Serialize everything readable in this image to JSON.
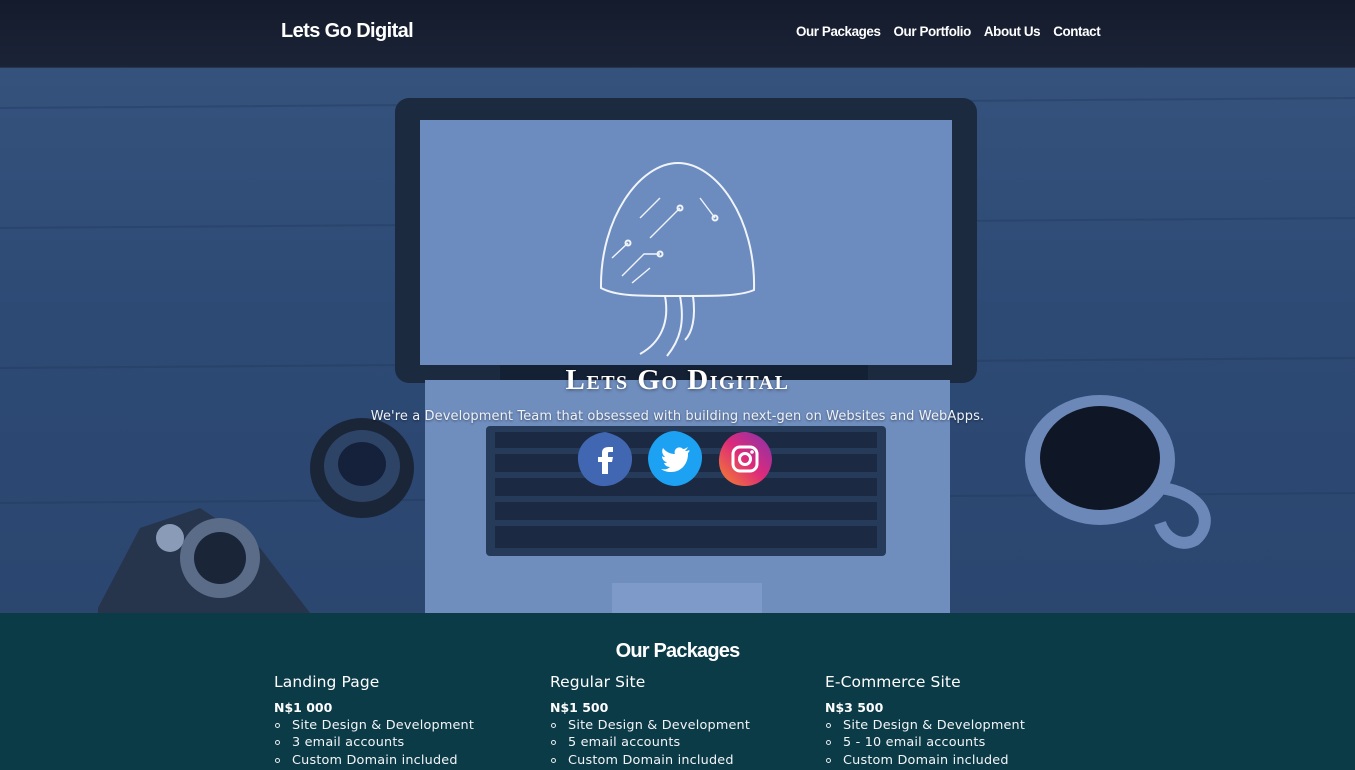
{
  "header": {
    "brand": "Lets Go Digital",
    "nav": [
      "Our Packages",
      "Our Portfolio",
      "About Us",
      "Contact"
    ]
  },
  "hero": {
    "title": "Lets Go Digital",
    "subtitle": "We're a Development Team that obsessed with building next-gen on Websites and WebApps.",
    "social": [
      {
        "icon": "facebook-icon",
        "color": "#4267b2"
      },
      {
        "icon": "twitter-icon",
        "color": "#1da1f2"
      },
      {
        "icon": "instagram-icon",
        "color": "#c13584"
      }
    ],
    "overlay_color": "#2e4c77"
  },
  "packages": {
    "title": "Our Packages",
    "items": [
      {
        "name": "Landing Page",
        "price": "N$1 000",
        "features": [
          "Site Design & Development",
          "3 email accounts",
          "Custom Domain included"
        ]
      },
      {
        "name": "Regular Site",
        "price": "N$1 500",
        "features": [
          "Site Design & Development",
          "5 email accounts",
          "Custom Domain included"
        ]
      },
      {
        "name": "E-Commerce Site",
        "price": "N$3 500",
        "features": [
          "Site Design & Development",
          "5 - 10 email accounts",
          "Custom Domain included"
        ]
      }
    ],
    "background": "#0c3b48"
  }
}
